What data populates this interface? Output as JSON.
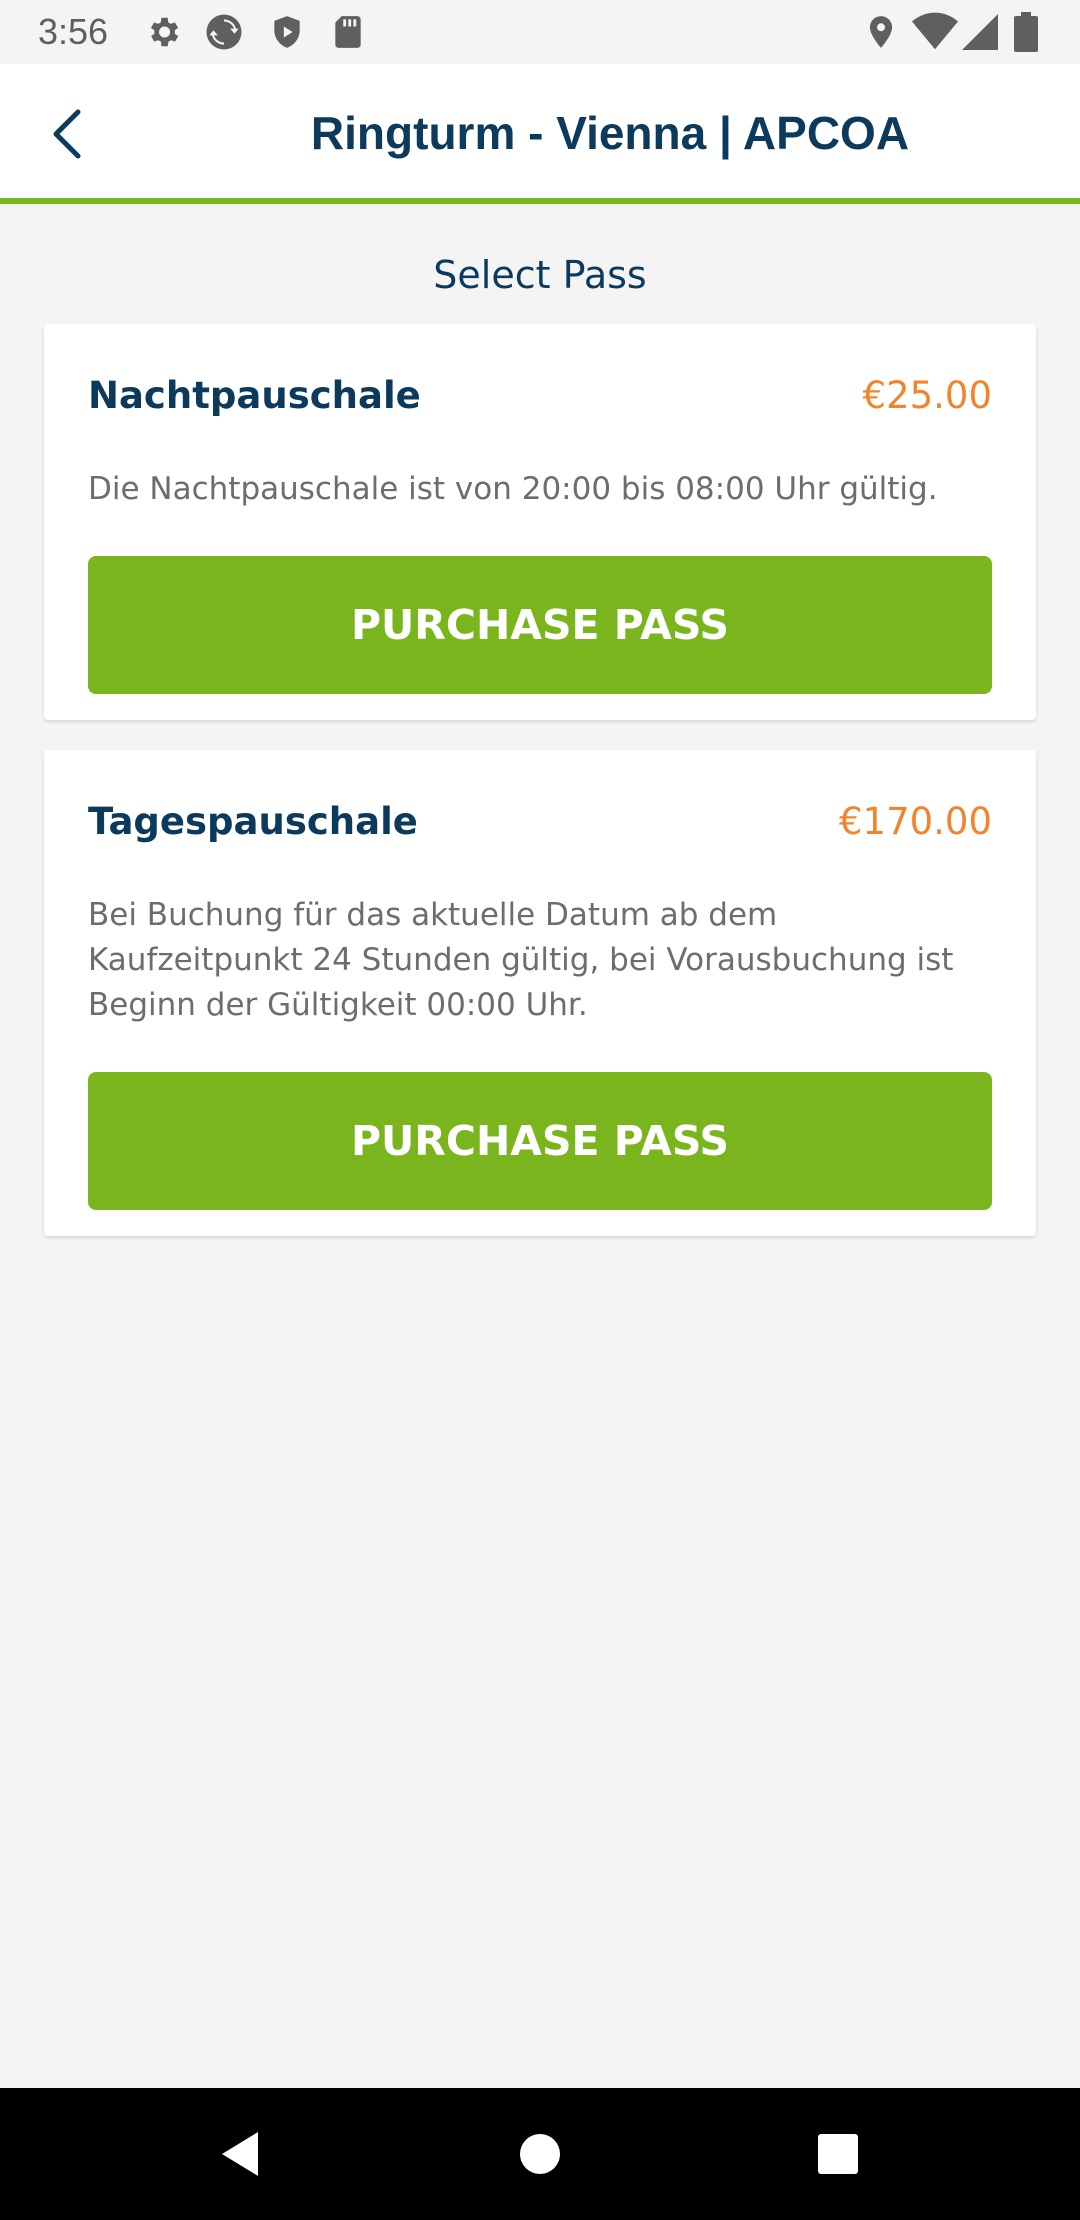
{
  "status_bar": {
    "time": "3:56",
    "left_icons": [
      "settings-icon",
      "sync-icon",
      "shield-play-icon",
      "sd-card-icon"
    ],
    "right_icons": [
      "location-icon",
      "wifi-icon",
      "signal-icon",
      "battery-icon"
    ]
  },
  "header": {
    "title": "Ringturm - Vienna | APCOA",
    "back_icon": "chevron-left-icon"
  },
  "page": {
    "heading": "Select Pass"
  },
  "passes": [
    {
      "name": "Nachtpauschale",
      "price": "€25.00",
      "description": "Die Nachtpauschale ist von 20:00 bis 08:00 Uhr gültig.",
      "button_label": "PURCHASE PASS"
    },
    {
      "name": "Tagespauschale",
      "price": "€170.00",
      "description": "Bei Buchung für das aktuelle Datum ab dem Kaufzeitpunkt 24 Stunden gültig, bei Vorausbuchung ist Beginn der Gültigkeit 00:00 Uhr.",
      "button_label": "PURCHASE PASS"
    }
  ],
  "nav_bar": {
    "icons": [
      "back-triangle-icon",
      "home-circle-icon",
      "recents-square-icon"
    ]
  },
  "colors": {
    "accent_green": "#7ab51d",
    "title_navy": "#0b3a5c",
    "price_orange": "#f0852d",
    "background": "#f4f4f4"
  }
}
